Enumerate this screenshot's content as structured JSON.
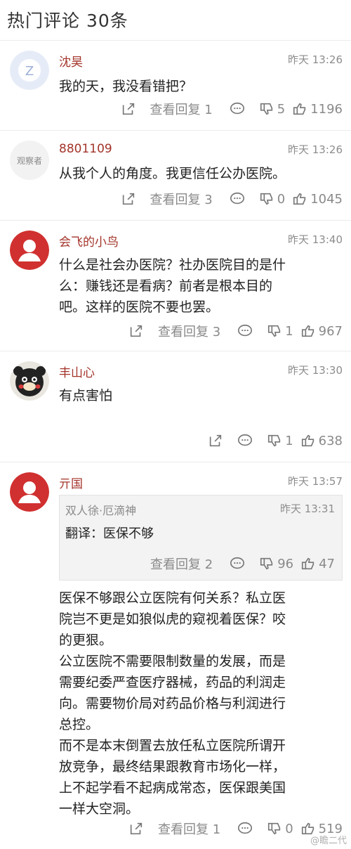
{
  "header": {
    "title": "热门评论 30条"
  },
  "comments": [
    {
      "user": "沈昊",
      "time": "昨天 13:26",
      "lines": [
        "我的天，我没看错把？"
      ],
      "reply": "查看回复 1",
      "dislikes": "5",
      "likes": "1196"
    },
    {
      "user": "8801109",
      "time": "昨天 13:26",
      "avatar_text": "观察者",
      "lines": [
        "从我个人的角度。我更信任公办医院。"
      ],
      "reply": "查看回复 3",
      "dislikes": "0",
      "likes": "1045"
    },
    {
      "user": "会飞的小鸟",
      "time": "昨天 13:40",
      "lines": [
        "什么是社会办医院？社办医院目的是什",
        "么：赚钱还是看病？前者是根本目的",
        "吧。这样的医院不要也罢。"
      ],
      "reply": "查看回复 3",
      "dislikes": "1",
      "likes": "967"
    },
    {
      "user": "丰山心",
      "time": "昨天 13:30",
      "lines": [
        "有点害怕"
      ],
      "dislikes": "1",
      "likes": "638"
    },
    {
      "user": "亓国",
      "time": "昨天 13:57",
      "quote": {
        "user": "双人徐·厄滴神",
        "time": "昨天 13:31",
        "text": "翻译：医保不够",
        "reply": "查看回复 2",
        "dislikes": "96",
        "likes": "47"
      },
      "lines": [
        "医保不够跟公立医院有何关系？私立医",
        "院岂不更是如狼似虎的窥视着医保？咬",
        "的更狠。",
        "公立医院不需要限制数量的发展，而是",
        "需要纪委严查医疗器械，药品的利润走",
        "向。需要物价局对药品价格与利润进行",
        "总控。",
        "而不是本末倒置去放任私立医院所谓开",
        "放竞争，最终结果跟教育市场化一样，",
        "上不起学看不起病成常态，医保跟美国",
        "一样大空洞。"
      ],
      "reply": "查看回复 1",
      "dislikes": "0",
      "likes": "519"
    }
  ],
  "watermark": "@瞻二代",
  "colors": {
    "username": "#a3342a",
    "meta": "#8a8a8a",
    "divider": "#ececec"
  }
}
